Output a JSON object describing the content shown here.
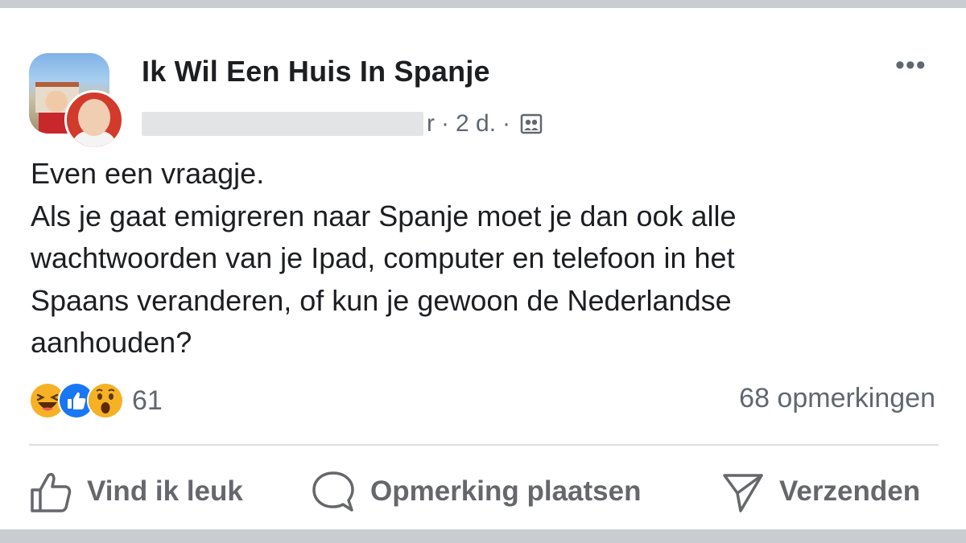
{
  "post": {
    "group_name": "Ik Wil Een Huis In Spanje",
    "author_visible_tail": "r",
    "time": "2 d.",
    "separator": "·",
    "more_label": "•••",
    "body_lines": [
      "Even een vraagje.",
      "Als je gaat emigreren naar Spanje moet je dan ook alle",
      "wachtwoorden van je Ipad, computer en telefoon in het",
      "Spaans veranderen, of kun je gewoon de Nederlandse",
      "aanhouden?"
    ],
    "reactions": {
      "icons": [
        "haha-icon",
        "like-icon",
        "wow-icon"
      ],
      "count": "61"
    },
    "comments_label": "68 opmerkingen",
    "actions": {
      "like": "Vind ik leuk",
      "comment": "Opmerking plaatsen",
      "send": "Verzenden"
    }
  },
  "colors": {
    "like_blue": "#1877f2",
    "reaction_yellow": "#f7b125",
    "secondary_text": "#606770"
  }
}
